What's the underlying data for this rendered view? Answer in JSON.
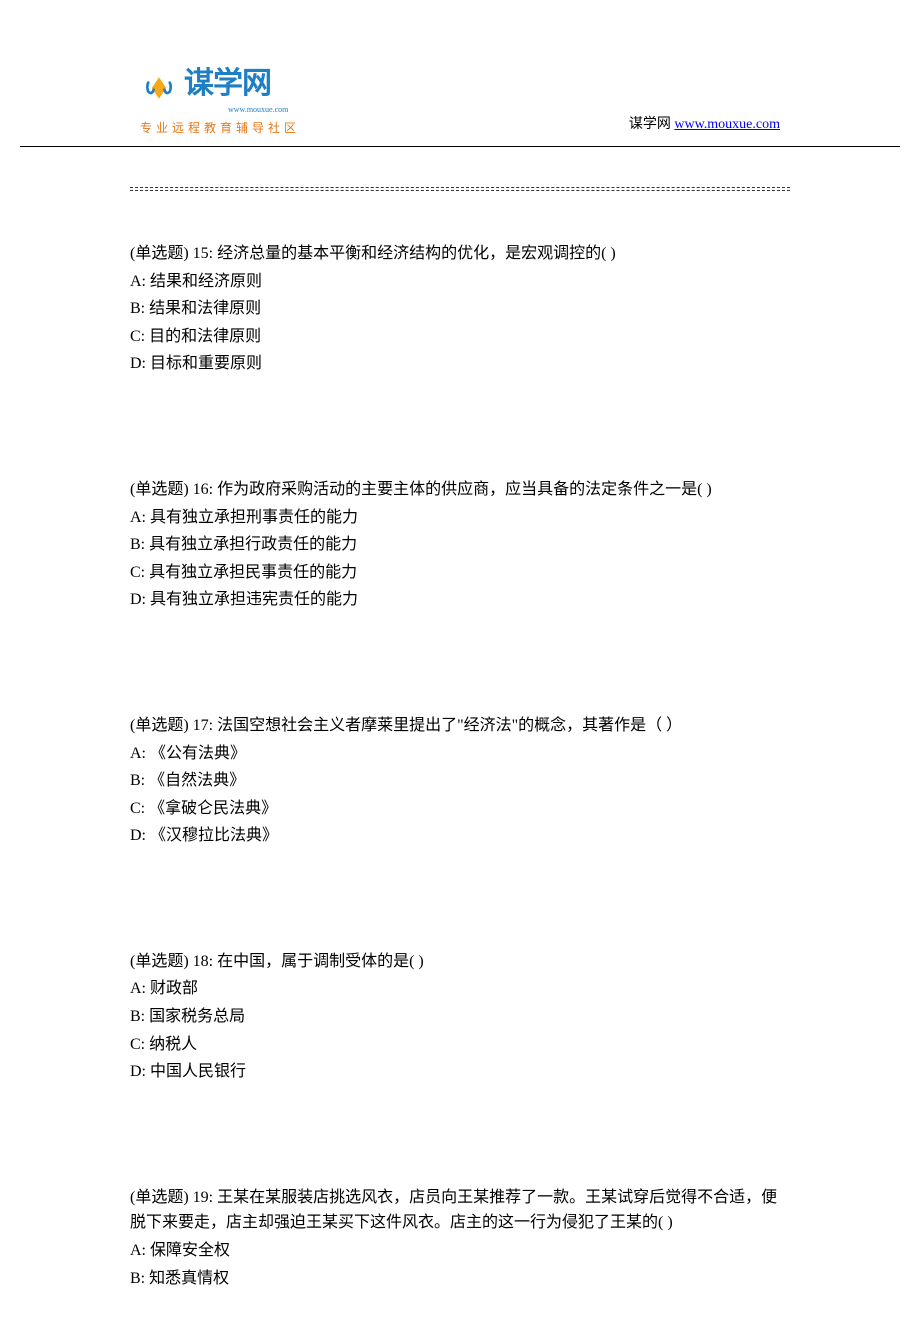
{
  "header": {
    "logo_main": "谋学网",
    "logo_sub": "www.mouxue.com",
    "logo_tagline": "专业远程教育辅导社区",
    "brand_text": "谋学网",
    "domain_link": "www.mouxue.com"
  },
  "questions": [
    {
      "stem": "(单选题) 15: 经济总量的基本平衡和经济结构的优化，是宏观调控的( )",
      "options": [
        "A: 结果和经济原则",
        "B: 结果和法律原则",
        "C: 目的和法律原则",
        "D: 目标和重要原则"
      ]
    },
    {
      "stem": "(单选题) 16: 作为政府采购活动的主要主体的供应商，应当具备的法定条件之一是( )",
      "options": [
        "A: 具有独立承担刑事责任的能力",
        "B: 具有独立承担行政责任的能力",
        "C: 具有独立承担民事责任的能力",
        "D: 具有独立承担违宪责任的能力"
      ]
    },
    {
      "stem": "(单选题) 17: 法国空想社会主义者摩莱里提出了\"经济法\"的概念，其著作是（ ）",
      "options": [
        "A: 《公有法典》",
        "B: 《自然法典》",
        "C: 《拿破仑民法典》",
        "D: 《汉穆拉比法典》"
      ]
    },
    {
      "stem": "(单选题) 18: 在中国，属于调制受体的是( )",
      "options": [
        "A: 财政部",
        "B: 国家税务总局",
        "C: 纳税人",
        "D: 中国人民银行"
      ]
    },
    {
      "stem": "(单选题) 19: 王某在某服装店挑选风衣，店员向王某推荐了一款。王某试穿后觉得不合适，便脱下来要走，店主却强迫王某买下这件风衣。店主的这一行为侵犯了王某的( )",
      "options": [
        "A: 保障安全权",
        "B: 知悉真情权"
      ]
    }
  ]
}
